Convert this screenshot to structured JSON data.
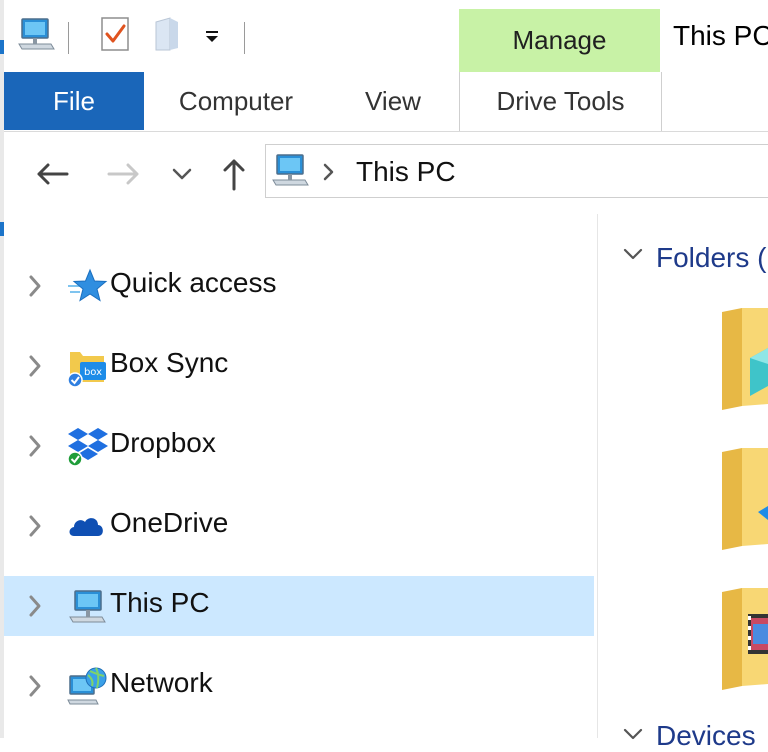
{
  "window": {
    "title": "This PC"
  },
  "ribbon": {
    "contextual_group": "Manage",
    "tabs": [
      {
        "label": "File"
      },
      {
        "label": "Computer"
      },
      {
        "label": "View"
      },
      {
        "label": "Drive Tools"
      }
    ]
  },
  "address_bar": {
    "path": "This PC"
  },
  "nav_pane": {
    "items": [
      {
        "label": "Quick access"
      },
      {
        "label": "Box Sync"
      },
      {
        "label": "Dropbox"
      },
      {
        "label": "OneDrive"
      },
      {
        "label": "This PC",
        "selected": true
      },
      {
        "label": "Network"
      }
    ]
  },
  "content": {
    "sections": [
      {
        "label": "Folders ("
      },
      {
        "label": "Devices"
      }
    ]
  },
  "colors": {
    "file_tab": "#1a66b9",
    "manage_tab": "#c8f2a6",
    "selection": "#cce8ff",
    "section_header": "#1e3a8a"
  }
}
